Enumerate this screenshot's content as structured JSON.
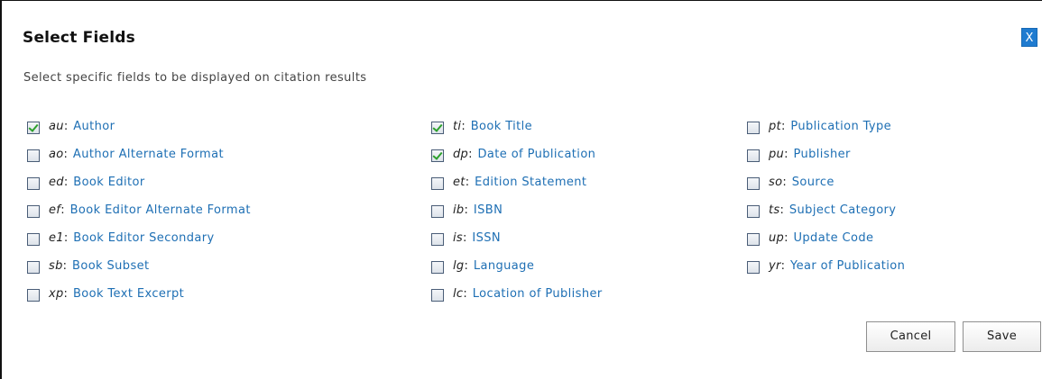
{
  "dialog": {
    "title": "Select Fields",
    "close_label": "X",
    "subtitle": "Select specific fields to be displayed on citation results"
  },
  "columns": [
    [
      {
        "code": "au",
        "label": "Author",
        "checked": true
      },
      {
        "code": "ao",
        "label": "Author Alternate Format",
        "checked": false
      },
      {
        "code": "ed",
        "label": "Book Editor",
        "checked": false
      },
      {
        "code": "ef",
        "label": "Book Editor Alternate Format",
        "checked": false
      },
      {
        "code": "e1",
        "label": "Book Editor Secondary",
        "checked": false
      },
      {
        "code": "sb",
        "label": "Book Subset",
        "checked": false
      },
      {
        "code": "xp",
        "label": "Book Text Excerpt",
        "checked": false
      }
    ],
    [
      {
        "code": "ti",
        "label": "Book Title",
        "checked": true
      },
      {
        "code": "dp",
        "label": "Date of Publication",
        "checked": true
      },
      {
        "code": "et",
        "label": "Edition Statement",
        "checked": false
      },
      {
        "code": "ib",
        "label": "ISBN",
        "checked": false
      },
      {
        "code": "is",
        "label": "ISSN",
        "checked": false
      },
      {
        "code": "lg",
        "label": "Language",
        "checked": false
      },
      {
        "code": "lc",
        "label": "Location of Publisher",
        "checked": false
      }
    ],
    [
      {
        "code": "pt",
        "label": "Publication Type",
        "checked": false
      },
      {
        "code": "pu",
        "label": "Publisher",
        "checked": false
      },
      {
        "code": "so",
        "label": "Source",
        "checked": false
      },
      {
        "code": "ts",
        "label": "Subject Category",
        "checked": false
      },
      {
        "code": "up",
        "label": "Update Code",
        "checked": false
      },
      {
        "code": "yr",
        "label": "Year of Publication",
        "checked": false
      }
    ]
  ],
  "buttons": {
    "cancel_label": "Cancel",
    "save_label": "Save"
  },
  "colors": {
    "link": "#1e6fb4",
    "close_button": "#1f7bd0",
    "check": "#2ca02c"
  }
}
